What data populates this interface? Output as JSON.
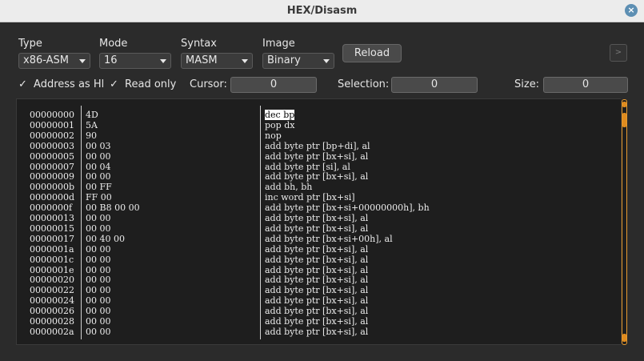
{
  "window": {
    "title": "HEX/Disasm",
    "close_glyph": "×"
  },
  "controls": {
    "type_label": "Type",
    "type_value": "x86-ASM",
    "mode_label": "Mode",
    "mode_value": "16",
    "syntax_label": "Syntax",
    "syntax_value": "MASM",
    "image_label": "Image",
    "image_value": "Binary",
    "reload_label": "Reload",
    "small_button_glyph": ">",
    "address_as_hex_label": "Address as HEX",
    "read_only_label": "Read only",
    "check_glyph": "✓",
    "cursor_label": "Cursor:",
    "cursor_value": "0",
    "selection_label": "Selection:",
    "selection_value": "0",
    "size_label": "Size:",
    "size_value": "0"
  },
  "listing": {
    "rows": [
      {
        "addr": "00000000",
        "hex": "4D",
        "asm": "dec bp"
      },
      {
        "addr": "00000001",
        "hex": "5A",
        "asm": "pop dx"
      },
      {
        "addr": "00000002",
        "hex": "90",
        "asm": "nop"
      },
      {
        "addr": "00000003",
        "hex": "00 03",
        "asm": "add byte ptr [bp+di], al"
      },
      {
        "addr": "00000005",
        "hex": "00 00",
        "asm": "add byte ptr [bx+si], al"
      },
      {
        "addr": "00000007",
        "hex": "00 04",
        "asm": "add byte ptr [si], al"
      },
      {
        "addr": "00000009",
        "hex": "00 00",
        "asm": "add byte ptr [bx+si], al"
      },
      {
        "addr": "0000000b",
        "hex": "00 FF",
        "asm": "add bh, bh"
      },
      {
        "addr": "0000000d",
        "hex": "FF 00",
        "asm": "inc word ptr [bx+si]"
      },
      {
        "addr": "0000000f",
        "hex": "00 B8 00 00",
        "asm": "add byte ptr [bx+si+00000000h], bh"
      },
      {
        "addr": "00000013",
        "hex": "00 00",
        "asm": "add byte ptr [bx+si], al"
      },
      {
        "addr": "00000015",
        "hex": "00 00",
        "asm": "add byte ptr [bx+si], al"
      },
      {
        "addr": "00000017",
        "hex": "00 40 00",
        "asm": "add byte ptr [bx+si+00h], al"
      },
      {
        "addr": "0000001a",
        "hex": "00 00",
        "asm": "add byte ptr [bx+si], al"
      },
      {
        "addr": "0000001c",
        "hex": "00 00",
        "asm": "add byte ptr [bx+si], al"
      },
      {
        "addr": "0000001e",
        "hex": "00 00",
        "asm": "add byte ptr [bx+si], al"
      },
      {
        "addr": "00000020",
        "hex": "00 00",
        "asm": "add byte ptr [bx+si], al"
      },
      {
        "addr": "00000022",
        "hex": "00 00",
        "asm": "add byte ptr [bx+si], al"
      },
      {
        "addr": "00000024",
        "hex": "00 00",
        "asm": "add byte ptr [bx+si], al"
      },
      {
        "addr": "00000026",
        "hex": "00 00",
        "asm": "add byte ptr [bx+si], al"
      },
      {
        "addr": "00000028",
        "hex": "00 00",
        "asm": "add byte ptr [bx+si], al"
      },
      {
        "addr": "0000002a",
        "hex": "00 00",
        "asm": "add byte ptr [bx+si], al"
      }
    ]
  },
  "colors": {
    "accent": "#e08c1f",
    "background": "#2b2b2b",
    "listing_bg": "#1e1e1e"
  }
}
